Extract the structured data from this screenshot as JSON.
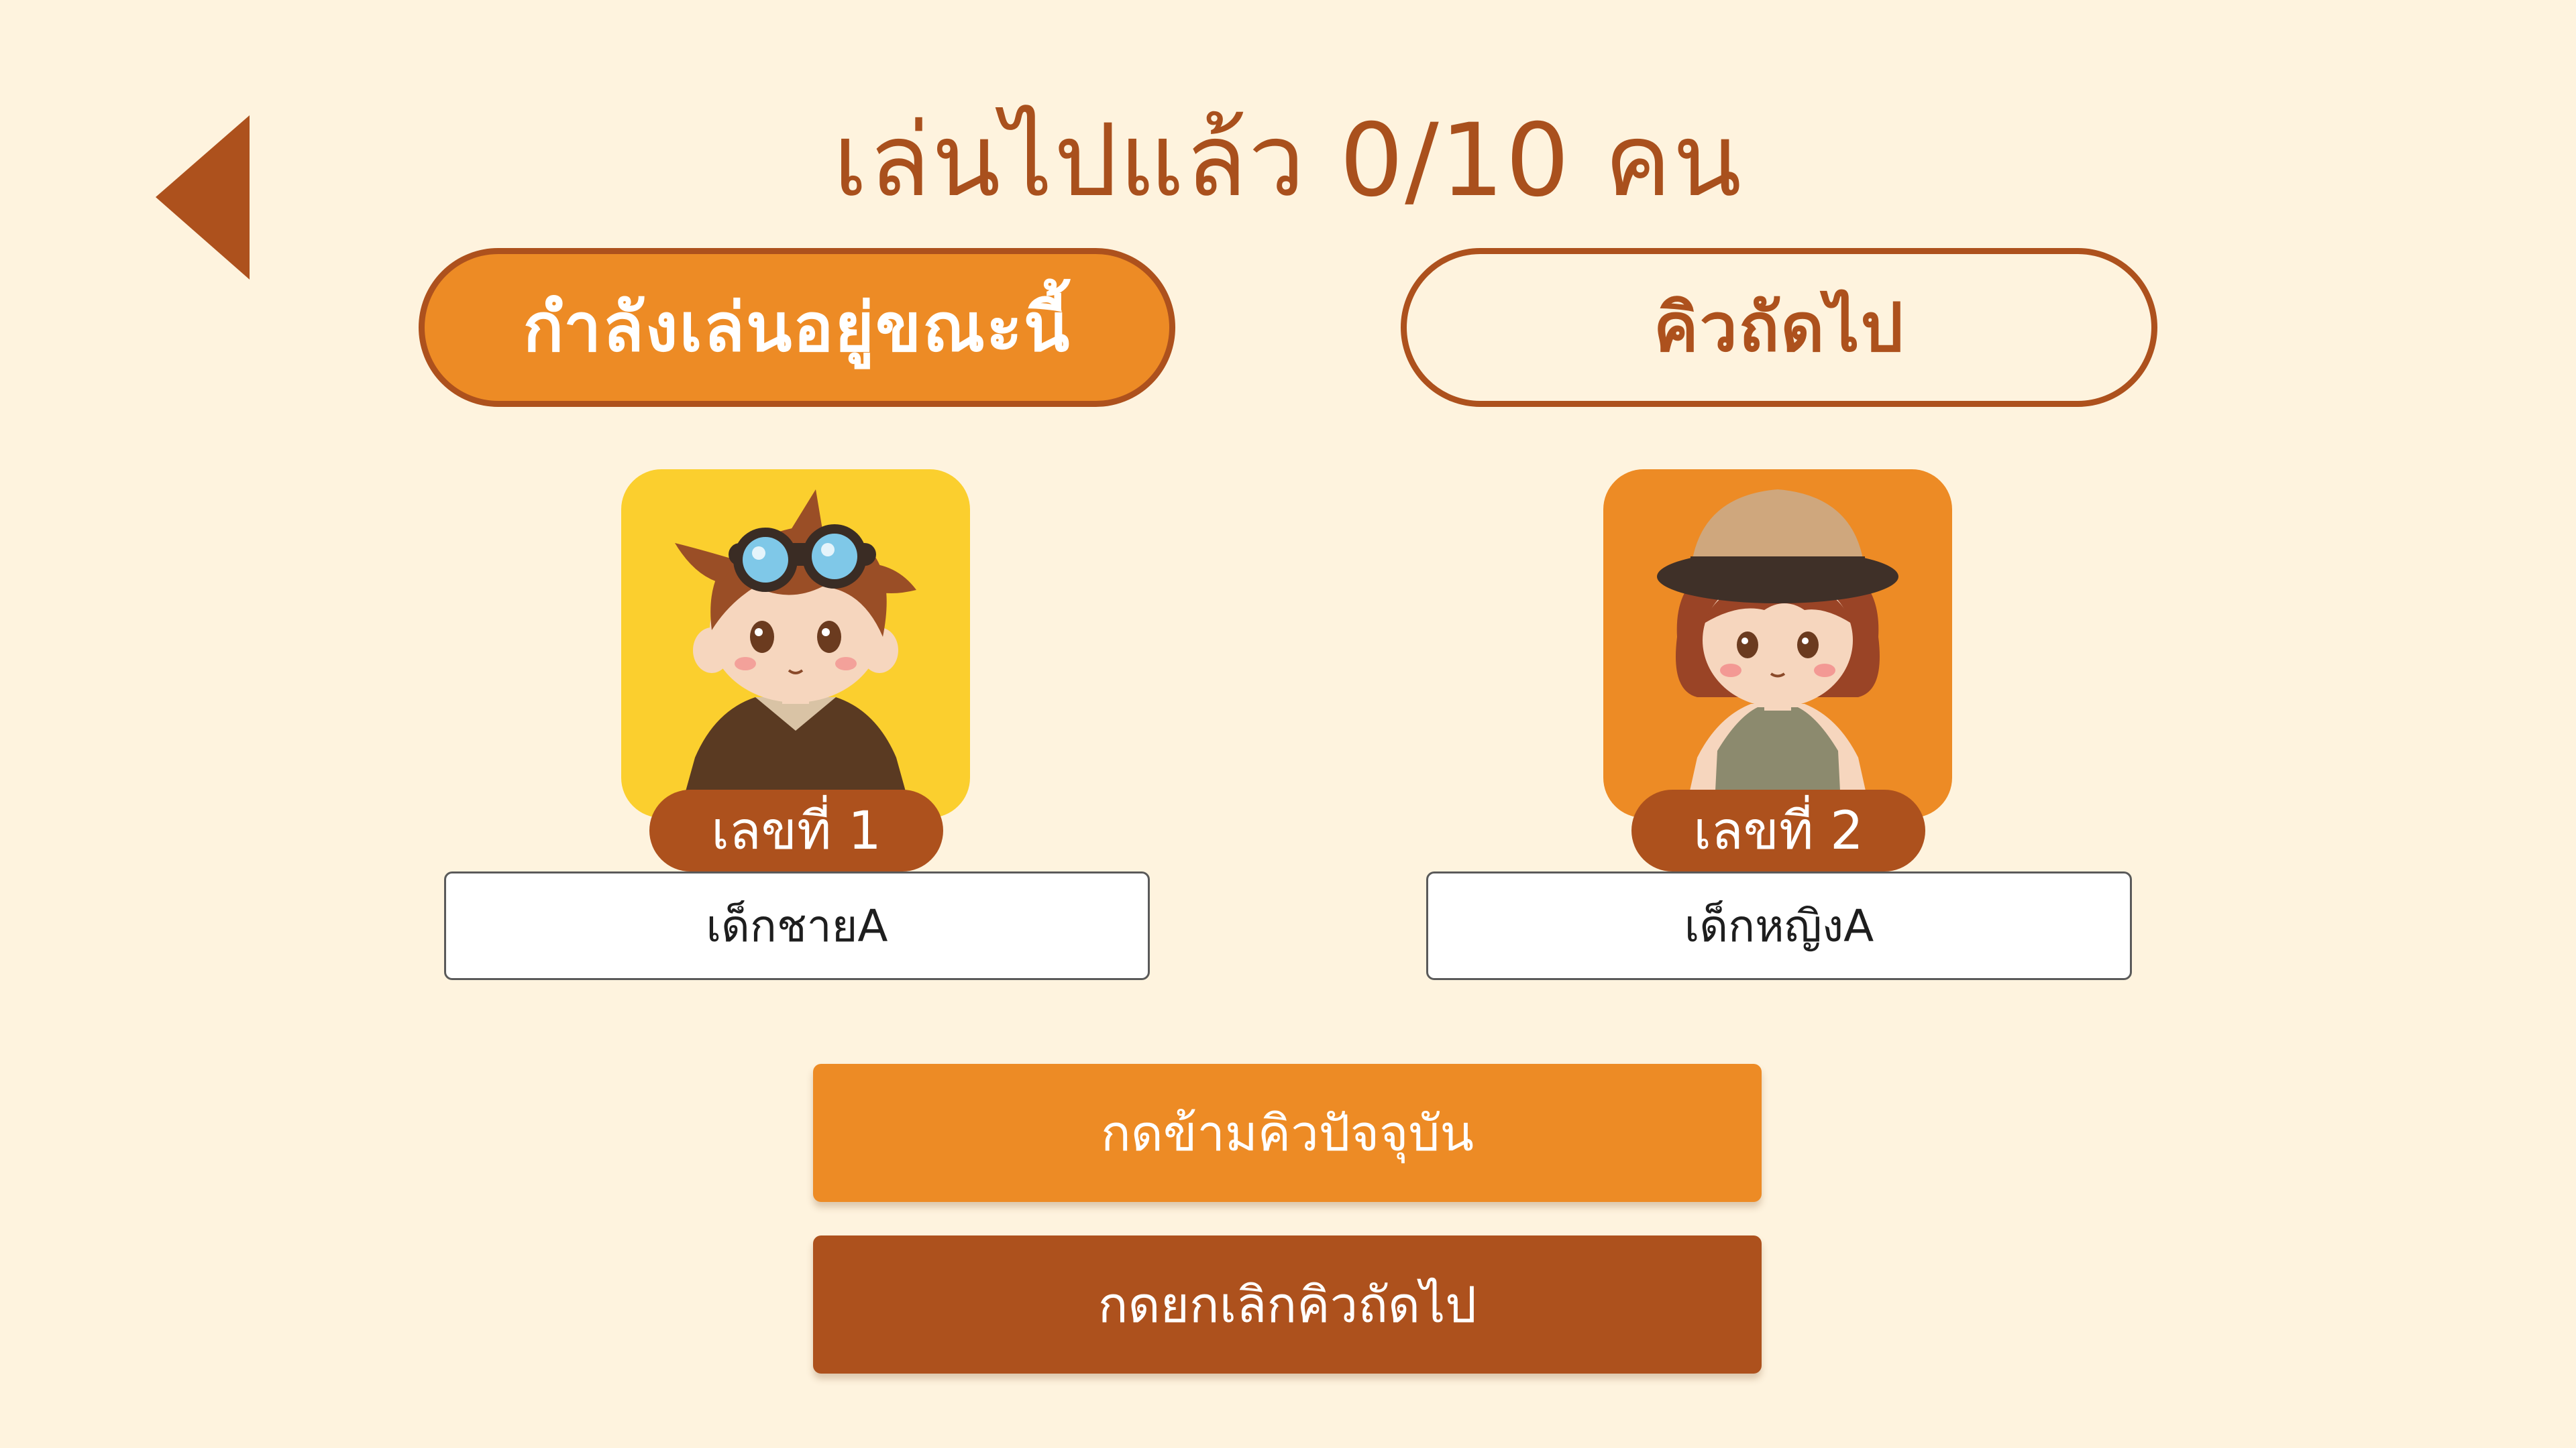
{
  "header": {
    "title": "เล่นไปแล้ว 0/10 คน",
    "back_icon": "triangle-left-icon"
  },
  "tabs": {
    "current_label": "กำลังเล่นอยู่ขณะนี้",
    "next_label": "คิวถัดไป"
  },
  "players": [
    {
      "number_label": "เลขที่ 1",
      "name": "เด็กชายA",
      "avatar_icon": "boy-aviator-avatar"
    },
    {
      "number_label": "เลขที่ 2",
      "name": "เด็กหญิงA",
      "avatar_icon": "girl-explorer-avatar"
    }
  ],
  "actions": {
    "skip_label": "กดข้ามคิวปัจจุบัน",
    "cancel_label": "กดยกเลิกคิวถัดไป"
  },
  "colors": {
    "background": "#fef3de",
    "primary_orange": "#ed8b25",
    "dark_brown": "#ad511d",
    "title_brown": "#a9501d",
    "yellow_tile": "#fbcf2e"
  }
}
